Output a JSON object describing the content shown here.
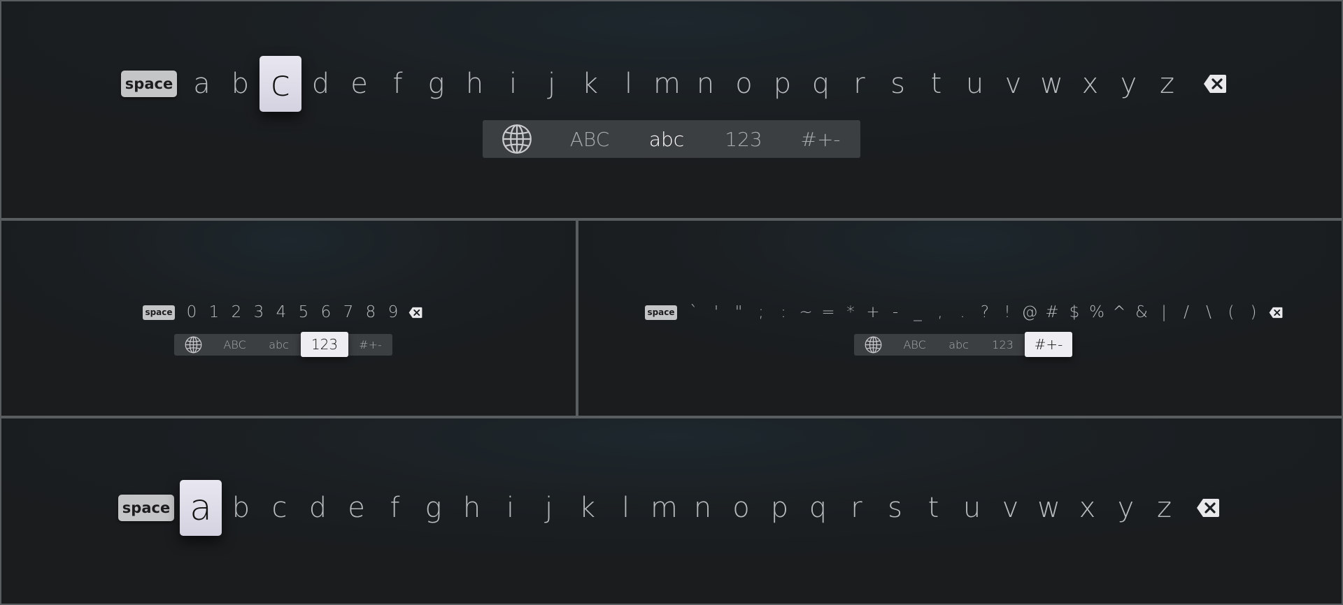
{
  "keyboard_lowercase_c": {
    "space_label": "space",
    "keys": [
      "a",
      "b",
      "c",
      "d",
      "e",
      "f",
      "g",
      "h",
      "i",
      "j",
      "k",
      "l",
      "m",
      "n",
      "o",
      "p",
      "q",
      "r",
      "s",
      "t",
      "u",
      "v",
      "w",
      "x",
      "y",
      "z"
    ],
    "focused_key": "c",
    "modes": [
      "ABC",
      "abc",
      "123",
      "#+-"
    ],
    "selected_mode": "abc"
  },
  "keyboard_numbers": {
    "space_label": "space",
    "keys": [
      "0",
      "1",
      "2",
      "3",
      "4",
      "5",
      "6",
      "7",
      "8",
      "9"
    ],
    "modes": [
      "ABC",
      "abc",
      "123",
      "#+-"
    ],
    "active_mode": "123"
  },
  "keyboard_symbols": {
    "space_label": "space",
    "keys": [
      "`",
      "'",
      "\"",
      ";",
      ":",
      "~",
      "=",
      "*",
      "+",
      "-",
      "_",
      ",",
      ".",
      "?",
      "!",
      "@",
      "#",
      "$",
      "%",
      "^",
      "&",
      "|",
      "/",
      "\\",
      "(",
      ")"
    ],
    "modes": [
      "ABC",
      "abc",
      "123",
      "#+-"
    ],
    "active_mode": "#+-"
  },
  "keyboard_lowercase_a": {
    "space_label": "space",
    "keys": [
      "a",
      "b",
      "c",
      "d",
      "e",
      "f",
      "g",
      "h",
      "i",
      "j",
      "k",
      "l",
      "m",
      "n",
      "o",
      "p",
      "q",
      "r",
      "s",
      "t",
      "u",
      "v",
      "w",
      "x",
      "y",
      "z"
    ],
    "focused_key": "a"
  },
  "icons": {
    "globe": "globe-icon",
    "delete": "delete-backspace-icon"
  },
  "colors": {
    "background": "#1b1f22",
    "key_text": "#b9bcbf",
    "focus_key": "#e2e1ec",
    "space_key": "#c4c5c7",
    "mode_bar": "#3c3f42"
  }
}
